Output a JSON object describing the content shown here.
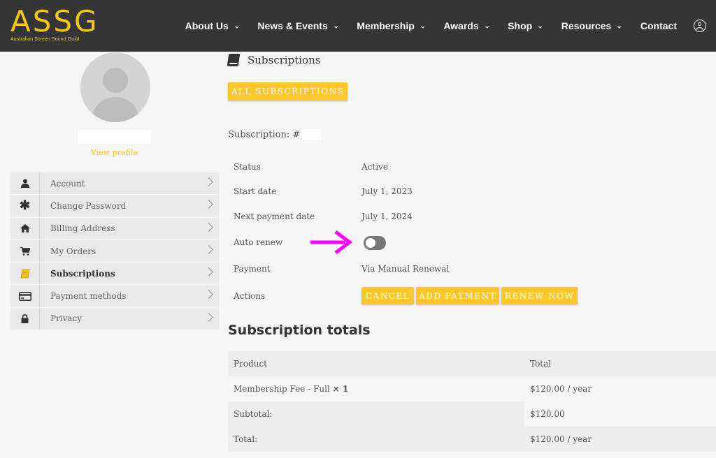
{
  "header": {
    "logo_text": "ASSG",
    "logo_subtitle": "Australian Screen Sound Guild",
    "nav": [
      "About Us",
      "News & Events",
      "Membership",
      "Awards",
      "Shop",
      "Resources",
      "Contact"
    ]
  },
  "profile": {
    "view_profile": "View profile"
  },
  "account_nav": [
    {
      "label": "Account",
      "icon": "person-icon"
    },
    {
      "label": "Change Password",
      "icon": "asterisk-icon"
    },
    {
      "label": "Billing Address",
      "icon": "home-icon"
    },
    {
      "label": "My Orders",
      "icon": "cart-icon"
    },
    {
      "label": "Subscriptions",
      "icon": "book-icon",
      "active": true
    },
    {
      "label": "Payment methods",
      "icon": "credit-card-icon"
    },
    {
      "label": "Privacy",
      "icon": "lock-icon"
    }
  ],
  "main": {
    "section_title": "Subscriptions",
    "all_subscriptions": "ALL SUBSCRIPTIONS",
    "subscription_label": "Subscription: #",
    "details": [
      {
        "label": "Status",
        "value": "Active"
      },
      {
        "label": "Start date",
        "value": "July 1, 2023"
      },
      {
        "label": "Next payment date",
        "value": "July 1, 2024"
      },
      {
        "label": "Auto renew",
        "value": ""
      },
      {
        "label": "Payment",
        "value": "Via Manual Renewal"
      },
      {
        "label": "Actions",
        "value": ""
      }
    ],
    "auto_renew_on": false,
    "actions": {
      "cancel": "CANCEL",
      "add_payment": "ADD PAYMENT",
      "renew_now": "RENEW NOW"
    },
    "totals_title": "Subscription totals",
    "totals_header": {
      "product": "Product",
      "total": "Total"
    },
    "totals_rows": [
      {
        "label": "Membership Fee - Full",
        "qty": "× 1",
        "value": "$120.00 / year"
      },
      {
        "label": "Subtotal:",
        "value": "$120.00"
      },
      {
        "label": "Total:",
        "value": "$120.00 / year"
      }
    ]
  },
  "colors": {
    "header_bg": "#333536",
    "brand_yellow": "#f5c518",
    "button_yellow": "#fcc72a",
    "annotation_arrow": "#ff00ff"
  }
}
